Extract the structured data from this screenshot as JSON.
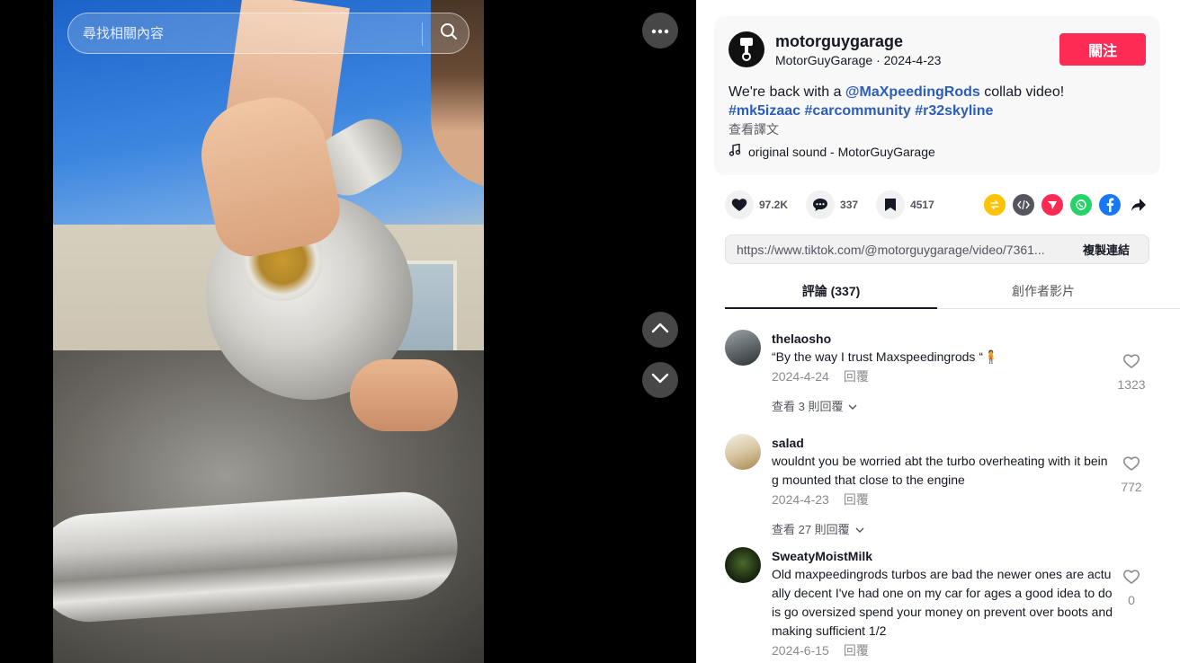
{
  "search": {
    "placeholder": "尋找相關內容"
  },
  "author": {
    "username": "motorguygarage",
    "display_name": "MotorGuyGarage",
    "date": "2024-4-23",
    "follow_label": "關注"
  },
  "post": {
    "text_prefix": "We're back with a ",
    "mention": "@MaXpeedingRods",
    "text_suffix": " collab video!",
    "hashtags": [
      "#mk5izaac",
      "#carcommunity",
      "#r32skyline"
    ],
    "translate_label": "查看譯文",
    "music": "original sound - MotorGuyGarage"
  },
  "stats": {
    "likes": "97.2K",
    "comments": "337",
    "saves": "4517"
  },
  "share_icons": [
    "repost-icon",
    "embed-icon",
    "send-icon",
    "whatsapp-icon",
    "facebook-icon",
    "share-arrow-icon"
  ],
  "link": {
    "url": "https://www.tiktok.com/@motorguygarage/video/7361...",
    "copy_label": "複製連結"
  },
  "tabs": {
    "comments": "評論 (337)",
    "creator_videos": "創作者影片"
  },
  "comments": [
    {
      "user": "thelaosho",
      "text": "“By the way I trust Maxspeedingrods “🧍",
      "date": "2024-4-24",
      "reply_label": "回覆",
      "likes": "1323",
      "more_replies": "查看 3 則回覆"
    },
    {
      "user": "salad",
      "text": "wouldnt you be worried abt the turbo overheating with it being mounted that close to the engine",
      "date": "2024-4-23",
      "reply_label": "回覆",
      "likes": "772",
      "more_replies": "查看 27 則回覆"
    },
    {
      "user": "SweatyMoistMilk",
      "text": "Old maxpeedingrods turbos are bad the newer ones are actually decent I've had one on my car for ages a good idea to do is go oversized spend your money on prevent over boots and making sufficient 1/2",
      "date": "2024-6-15",
      "reply_label": "回覆",
      "likes": "0"
    }
  ],
  "colors": {
    "accent": "#fe2c55",
    "hashtag": "#2b5db9"
  }
}
